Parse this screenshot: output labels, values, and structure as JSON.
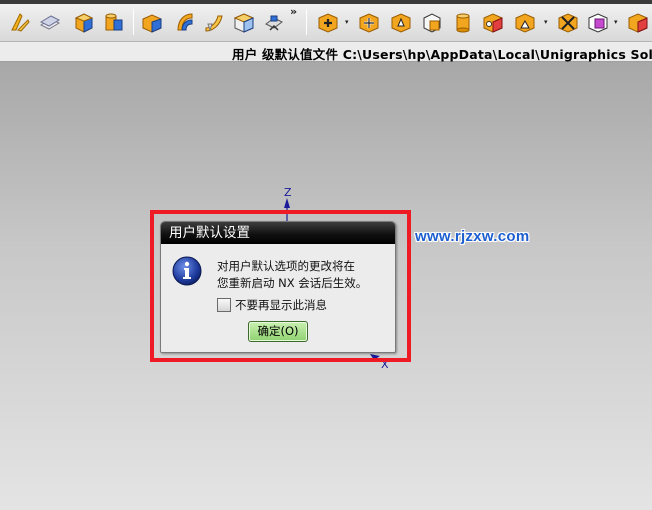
{
  "toolbar": {
    "more_glyph": "»",
    "dropdown_glyph": "▾",
    "icons": [
      "sketch-icon",
      "extrude-icon",
      "block-icon",
      "cylinder-icon",
      "box-icon",
      "revolve-icon",
      "sweep-icon",
      "cube-icon",
      "draft-icon",
      "unite-icon",
      "subtract-icon",
      "intersect-icon",
      "edge-blend-icon",
      "cone-icon",
      "chamfer-icon",
      "shell-icon",
      "trim-body-icon",
      "pattern-icon",
      "feature-icon"
    ]
  },
  "pathbar": {
    "text": "用户 级默认值文件 C:\\Users\\hp\\AppData\\Local\\Unigraphics Solutio"
  },
  "axes": {
    "z_label": "Z",
    "x_label": "X"
  },
  "dialog": {
    "title": "用户默认设置",
    "message_line1": "对用户默认选项的更改将在",
    "message_line2": "您重新启动 NX 会话后生效。",
    "checkbox_label": "不要再显示此消息",
    "checkbox_checked": false,
    "ok_label": "确定(O)"
  },
  "watermark": {
    "text": "www.rjzxw.com"
  },
  "colors": {
    "highlight": "#ee1b24",
    "watermark": "#1d5fd0",
    "title_bar": "#000000",
    "ok_button": "#a6df88"
  }
}
